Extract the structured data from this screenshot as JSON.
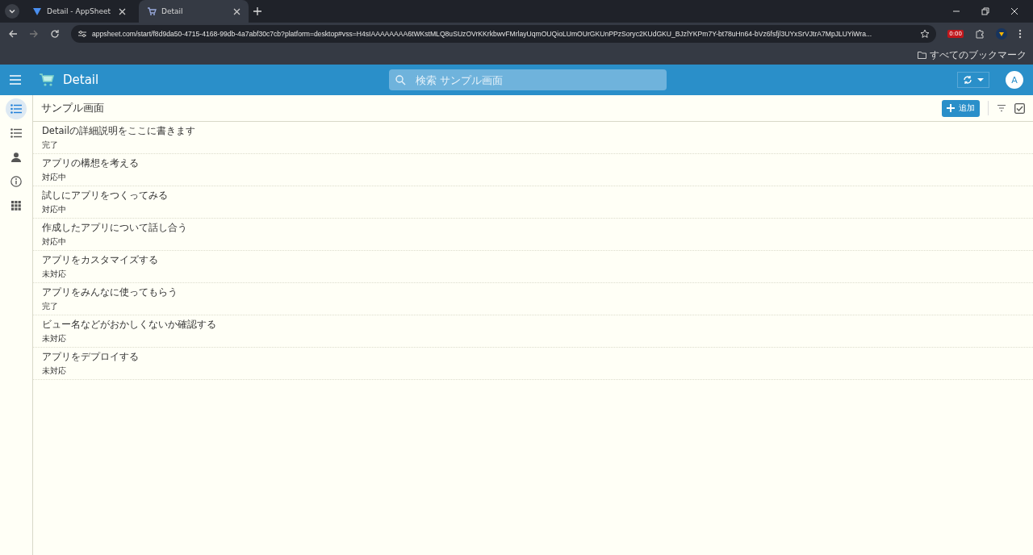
{
  "browser": {
    "tabs": [
      {
        "title": "Detail - AppSheet",
        "selected": false
      },
      {
        "title": "Detail",
        "selected": true
      }
    ],
    "address": "appsheet.com/start/f8d9da50-4715-4168-99db-4a7abf30c7cb?platform=desktop#vss=H4sIAAAAAAAA6tWKstMLQ8uSUzOVrKKrkbwvFMrlayUqmOUQioLUmOUrGKUnPPzSoryc2KUdGKU_BJzlYKPm7Y-bt78uHn64-bVz6fsfjl3UYxSrVJtrA7MpJLUYiWra...",
    "timer_badge": "0:00",
    "bookmarks_label": "すべてのブックマーク"
  },
  "app_header": {
    "title": "Detail",
    "search_placeholder": "検索 サンプル画面",
    "avatar": "A"
  },
  "sidebar": {
    "items": [
      {
        "kind": "list",
        "selected": true
      },
      {
        "kind": "list",
        "selected": false
      },
      {
        "kind": "person",
        "selected": false
      },
      {
        "kind": "info",
        "selected": false
      },
      {
        "kind": "grid",
        "selected": false
      }
    ]
  },
  "view": {
    "title": "サンプル画面",
    "add_button": "追加",
    "rows": [
      {
        "title": "Detailの詳細説明をここに書きます",
        "status": "完了"
      },
      {
        "title": "アプリの構想を考える",
        "status": "対応中"
      },
      {
        "title": "試しにアプリをつくってみる",
        "status": "対応中"
      },
      {
        "title": "作成したアプリについて話し合う",
        "status": "対応中"
      },
      {
        "title": "アプリをカスタマイズする",
        "status": "未対応"
      },
      {
        "title": "アプリをみんなに使ってもらう",
        "status": "完了"
      },
      {
        "title": "ビュー名などがおかしくないか確認する",
        "status": "未対応"
      },
      {
        "title": "アプリをデプロイする",
        "status": "未対応"
      }
    ]
  }
}
